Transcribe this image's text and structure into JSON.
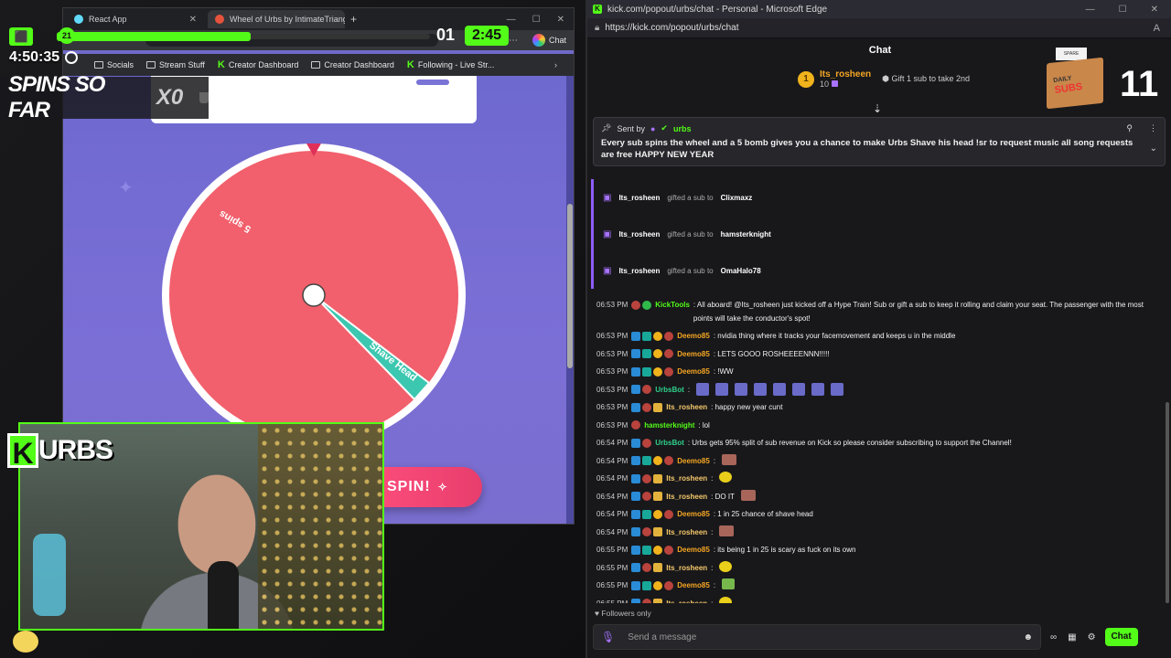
{
  "left_browser": {
    "tabs": [
      {
        "label": "React App",
        "active": false
      },
      {
        "label": "Wheel of Urbs by IntimateTriangle",
        "active": true
      }
    ],
    "chat_button": "Chat",
    "bookmarks": [
      "Socials",
      "Stream Stuff",
      "Creator Dashboard",
      "Creator Dashboard",
      "Following - Live Str..."
    ],
    "wheel": {
      "segments": [
        {
          "label": "5 spins",
          "color": "#f1606c"
        },
        {
          "label": "Shave Head",
          "color": "#3cc7b0"
        }
      ],
      "pointer_color": "#e0305a"
    },
    "spin_button": "SPIN!"
  },
  "overlay": {
    "hype_progress_level": "21",
    "hype_progress_fraction": 0.52,
    "hype_level": "01",
    "hype_timer": "2:45",
    "uptime": "4:50:35",
    "spins_label": "SPINS SO FAR",
    "spins_value": "X0",
    "logo_text": "URBS"
  },
  "edge_window": {
    "title": "kick.com/popout/urbs/chat - Personal - Microsoft Edge",
    "url": "https://kick.com/popout/urbs/chat"
  },
  "chat": {
    "header": "Chat",
    "top_gifter": {
      "rank": "1",
      "name": "Its_rosheen",
      "count": "10",
      "gift_text": "Gift 1 sub to take 2nd"
    },
    "subs_box": {
      "note": "SPARE FEET!?",
      "label1": "DAILY",
      "label2": "SUBS",
      "count": "11"
    },
    "pinned": {
      "sent_by_label": "Sent by",
      "sender": "urbs",
      "message": "Every sub spins the wheel and a 5 bomb gives you a chance to make Urbs Shave his head !sr to request music all song requests are free HAPPY NEW YEAR"
    },
    "gift_events": [
      {
        "user": "Its_rosheen",
        "action": "gifted a sub to",
        "target": "Clixmaxz"
      },
      {
        "user": "Its_rosheen",
        "action": "gifted a sub to",
        "target": "hamsterknight"
      },
      {
        "user": "Its_rosheen",
        "action": "gifted a sub to",
        "target": "OmaHalo78"
      }
    ],
    "messages": [
      {
        "ts": "06:53 PM",
        "user": "KickTools",
        "color": "#53fc18",
        "text": ": All aboard! @Its_rosheen just kicked off a Hype Train! Sub or gift a sub to keep it rolling and claim your seat. The passenger with the most points will take the conductor's spot!"
      },
      {
        "ts": "06:53 PM",
        "user": "Deemo85",
        "color": "#f5a623",
        "text": ": nvidia thing where it tracks your facemovement and keeps u in the middle"
      },
      {
        "ts": "06:53 PM",
        "user": "Deemo85",
        "color": "#f5a623",
        "text": ": LETS GOOO ROSHEEEENNN!!!!!"
      },
      {
        "ts": "06:53 PM",
        "user": "Deemo85",
        "color": "#f5a623",
        "text": ": !WW"
      },
      {
        "ts": "06:53 PM",
        "user": "UrbsBot",
        "color": "#2fd18b",
        "text": ":"
      },
      {
        "ts": "06:53 PM",
        "user": "Its_rosheen",
        "color": "#f5c86a",
        "text": ": happy new year cunt"
      },
      {
        "ts": "06:53 PM",
        "user": "hamsterknight",
        "color": "#53fc18",
        "text": ": lol"
      },
      {
        "ts": "06:54 PM",
        "user": "UrbsBot",
        "color": "#2fd18b",
        "text": ": Urbs gets 95% split of sub revenue on Kick so please consider subscribing to support the Channel!"
      },
      {
        "ts": "06:54 PM",
        "user": "Deemo85",
        "color": "#f5a623",
        "text": ":"
      },
      {
        "ts": "06:54 PM",
        "user": "Its_rosheen",
        "color": "#f5c86a",
        "text": ":"
      },
      {
        "ts": "06:54 PM",
        "user": "Its_rosheen",
        "color": "#f5c86a",
        "text": ": DO IT"
      },
      {
        "ts": "06:54 PM",
        "user": "Deemo85",
        "color": "#f5a623",
        "text": ": 1 in 25 chance of shave head"
      },
      {
        "ts": "06:54 PM",
        "user": "Its_rosheen",
        "color": "#f5c86a",
        "text": ":"
      },
      {
        "ts": "06:55 PM",
        "user": "Deemo85",
        "color": "#f5a623",
        "text": ": its being 1 in 25 is scary as fuck on its own"
      },
      {
        "ts": "06:55 PM",
        "user": "Its_rosheen",
        "color": "#f5c86a",
        "text": ":"
      },
      {
        "ts": "06:55 PM",
        "user": "Deemo85",
        "color": "#f5a623",
        "text": ":"
      },
      {
        "ts": "06:55 PM",
        "user": "Its_rosheen",
        "color": "#f5c86a",
        "text": ":"
      }
    ],
    "followers_only": "Followers only",
    "input_placeholder": "Send a message",
    "send_button": "Chat"
  }
}
